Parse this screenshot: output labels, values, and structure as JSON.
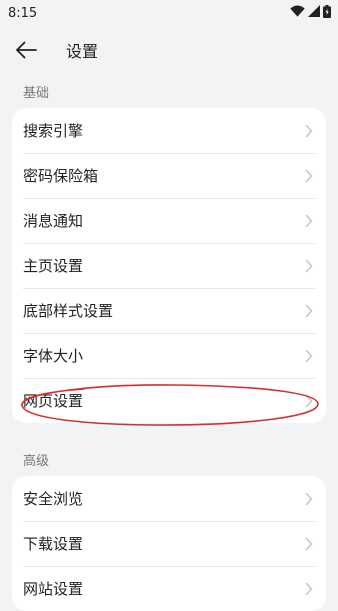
{
  "status_bar": {
    "time": "8:15",
    "icons": [
      "wifi-icon",
      "cellular-signal-icon",
      "battery-icon"
    ]
  },
  "app_bar": {
    "back_icon": "arrow-left-icon",
    "title": "设置"
  },
  "sections": [
    {
      "header": "基础",
      "items": [
        {
          "label": "搜索引擎"
        },
        {
          "label": "密码保险箱"
        },
        {
          "label": "消息通知"
        },
        {
          "label": "主页设置"
        },
        {
          "label": "底部样式设置"
        },
        {
          "label": "字体大小"
        },
        {
          "label": "网页设置",
          "highlighted": true
        }
      ]
    },
    {
      "header": "高级",
      "items": [
        {
          "label": "安全浏览"
        },
        {
          "label": "下载设置"
        },
        {
          "label": "网站设置"
        }
      ]
    }
  ],
  "annotation": {
    "shape": "ellipse",
    "color": "#d32f2f",
    "target": "网页设置"
  },
  "colors": {
    "background": "#f1f3f5",
    "card": "#ffffff",
    "chevron": "#c4c4c4",
    "section_header": "#7a7a7a"
  }
}
